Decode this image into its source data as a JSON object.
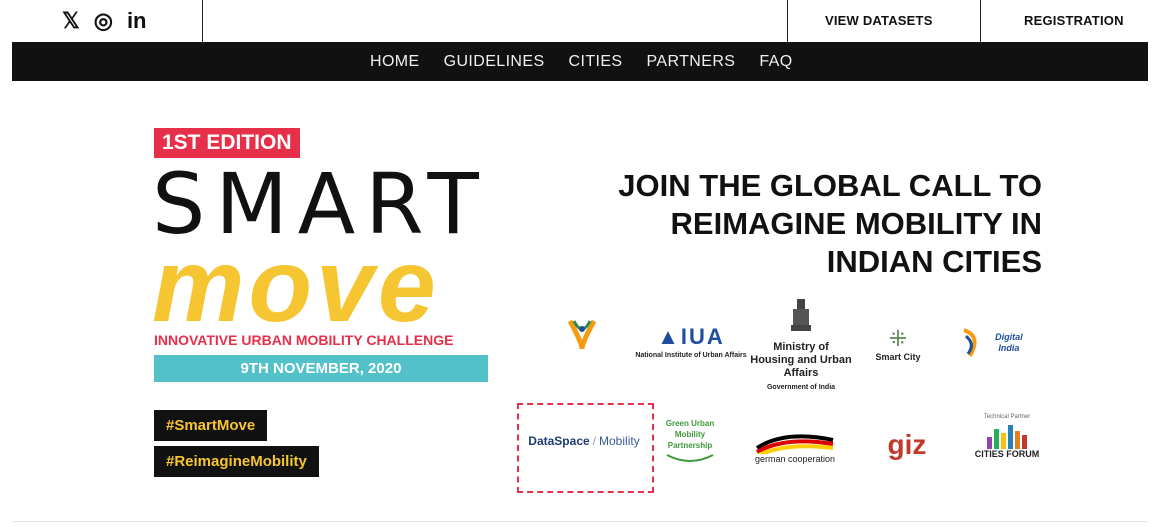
{
  "topbar": {
    "social": [
      "twitter-icon",
      "instagram-icon",
      "linkedin-icon"
    ],
    "view_datasets": "VIEW DATASETS",
    "registration": "REGISTRATION"
  },
  "nav": {
    "items": [
      "HOME",
      "GUIDELINES",
      "CITIES",
      "PARTNERS",
      "FAQ"
    ]
  },
  "hero": {
    "edition": "1ST EDITION",
    "smart": "SMART",
    "move": "move",
    "challenge": "INNOVATIVE URBAN MOBILITY CHALLENGE",
    "date": "9TH NOVEMBER, 2020",
    "tags": [
      "#SmartMove",
      "#ReimagineMobility"
    ],
    "headline_lines": [
      "JOIN THE GLOBAL CALL TO",
      "REIMAGINE MOBILITY IN",
      "INDIAN CITIES"
    ]
  },
  "partners": {
    "niua": "National Institute of Urban Affairs",
    "mohua_title": "Ministry of Housing and Urban Affairs",
    "mohua_sub": "Government of India",
    "smart_city": "Smart City",
    "digital_india": "Digital India",
    "dataspace": "DataSpace",
    "mobility": "Mobility",
    "gump": "Green Urban Mobility Partnership",
    "german_coop": "german cooperation",
    "giz": "giz",
    "cities_forum": "CITIES FORUM",
    "technical_partner": "Technical Partner"
  },
  "colors": {
    "accent_red": "#e63049",
    "accent_yellow": "#f6c532",
    "accent_teal": "#52c1c8",
    "nav_bg": "#111111"
  }
}
